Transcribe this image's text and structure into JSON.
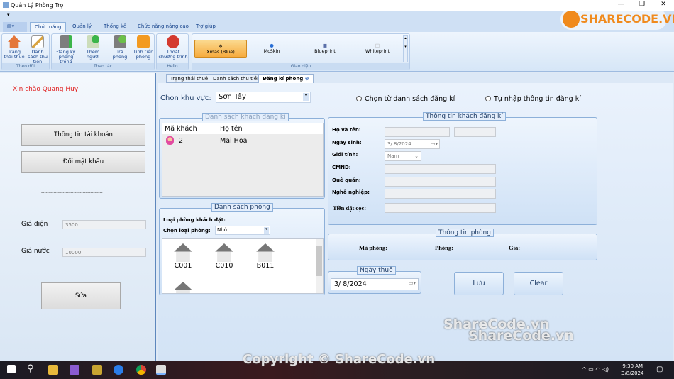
{
  "window": {
    "title": "Quản Lý Phòng Trọ",
    "minimize": "—",
    "restore": "❐",
    "close": "✕"
  },
  "ribbon": {
    "tabs": [
      "Chức năng",
      "Quản lý",
      "Thống kê",
      "Chức năng nâng cao",
      "Trợ giúp"
    ],
    "groups": [
      {
        "title": "Theo dõi",
        "buttons": [
          "Trạng thái thuê",
          "Danh sách thu tiền"
        ]
      },
      {
        "title": "Thao tác",
        "buttons": [
          "Đăng ký phòng trống",
          "Thêm người",
          "Trả phòng",
          "Tính tiền phòng"
        ]
      },
      {
        "title": "Hello",
        "buttons": [
          "Thoát chương trình"
        ]
      },
      {
        "title": "Giao diện",
        "skins": [
          "Xmas (Blue)",
          "McSkin",
          "Blueprint",
          "Whiteprint"
        ],
        "selected": "Xmas (Blue)"
      }
    ]
  },
  "left": {
    "greeting": "Xin chào Quang Huy",
    "account_btn": "Thông tin tài khoản",
    "password_btn": "Đổi mật khẩu",
    "separator": "----------------------------------------",
    "elec_label": "Giá điện",
    "elec_value": "3500",
    "water_label": "Giá nước",
    "water_value": "10000",
    "edit_btn": "Sửa"
  },
  "doc_tabs": [
    "Trạng thái thuê",
    "Danh sách thu tiền",
    "Đăng kí phòng"
  ],
  "main": {
    "area_label": "Chọn khu vực:",
    "area_value": "Sơn Tây",
    "radio1": "Chọn từ danh sách đăng kí",
    "radio2": "Tự nhập thông tin đăng kí",
    "customers": {
      "title": "Danh sách khách đăng kí",
      "columns": [
        "Mã khách",
        "Họ tên"
      ],
      "rows": [
        {
          "id": "2",
          "name": "Mai Hoa"
        }
      ]
    },
    "rooms": {
      "title": "Danh sách phòng",
      "type_label": "Loại phòng khách đặt:",
      "choose_label": "Chọn loại phòng:",
      "choose_value": "Nhỏ",
      "items": [
        "C001",
        "C010",
        "B011",
        ""
      ]
    },
    "info": {
      "title": "Thông tin khách đăng kí",
      "name": "Họ và tên:",
      "dob": "Ngày sinh:",
      "dob_value": "3/  8/2024",
      "gender": "Giới tính:",
      "gender_value": "Nam",
      "id": "CMND:",
      "hometown": "Quê quán:",
      "job": "Nghề nghiệp:",
      "deposit": "Tiền đặt cọc:"
    },
    "room_info": {
      "title": "Thông tin phòng",
      "code": "Mã phòng:",
      "room": "Phòng:",
      "price": "Giá:"
    },
    "rent_date": {
      "title": "Ngày thuê",
      "value": "3/  8/2024"
    },
    "save_btn": "Lưu",
    "clear_btn": "Clear"
  },
  "taskbar": {
    "time": "9:30 AM",
    "date": "3/8/2024"
  },
  "watermarks": {
    "logo": "SHARECODE.VN",
    "center": "ShareCode.vn",
    "copyright": "Copyright © ShareCode.vn"
  }
}
